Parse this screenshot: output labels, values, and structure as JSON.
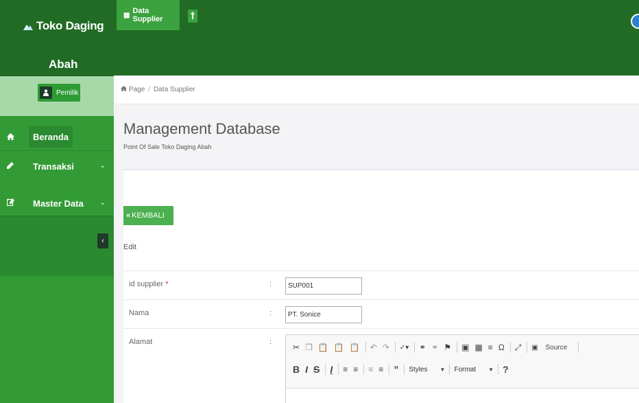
{
  "app": {
    "brand_line1": "Toko Daging",
    "brand_line2": "Abah",
    "user_role": "Pemilik"
  },
  "sidebar": {
    "items": [
      {
        "label": "Beranda",
        "icon": "home-icon"
      },
      {
        "label": "Transaksi",
        "icon": "pencil-icon"
      },
      {
        "label": "Master Data",
        "icon": "edit-icon"
      }
    ]
  },
  "topbar": {
    "tab_label": "Data Supplier",
    "notification_icon": "1"
  },
  "breadcrumb": {
    "home": "Page",
    "current": "Data Supplier"
  },
  "page": {
    "title": "Management Database",
    "subtitle": "Point Of Sale Toko Daging Abah"
  },
  "card": {
    "back_label": "KEMBALI",
    "section_label": "Edit"
  },
  "form": {
    "id_supplier_label": "id supplier",
    "required_mark": "*",
    "id_supplier_value": "SUP001",
    "nama_label": "Nama",
    "nama_value": "PT. Sonice",
    "alamat_label": "Alamat",
    "colon": ":"
  },
  "editor": {
    "source_label": "Source",
    "styles_label": "Styles",
    "format_label": "Format"
  },
  "colors": {
    "sidebar": "#339b36",
    "topbar": "#216b25",
    "accent": "#4cb050",
    "required": "#e0282d"
  }
}
